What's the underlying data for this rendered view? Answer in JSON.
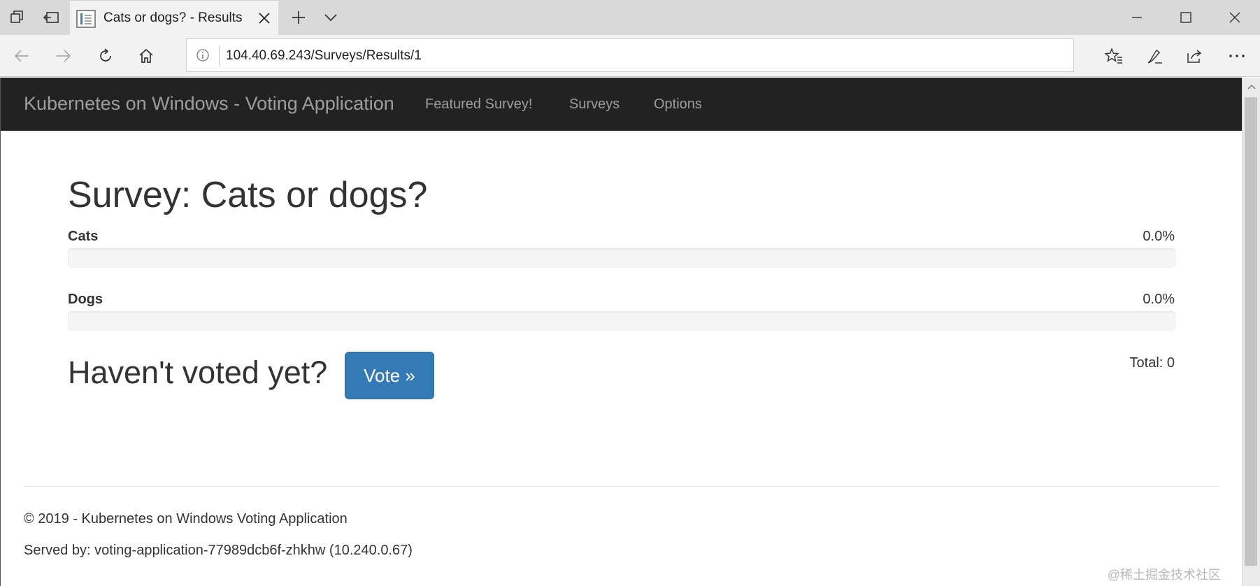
{
  "browser": {
    "tab": {
      "title": "Cats or dogs? - Results"
    },
    "address": {
      "url": "104.40.69.243/Surveys/Results/1"
    }
  },
  "app": {
    "brand": "Kubernetes on Windows - Voting Application",
    "nav": [
      {
        "label": "Featured Survey!"
      },
      {
        "label": "Surveys"
      },
      {
        "label": "Options"
      }
    ]
  },
  "survey": {
    "title": "Survey: Cats or dogs?",
    "options": [
      {
        "label": "Cats",
        "percent_text": "0.0%",
        "percent": 0
      },
      {
        "label": "Dogs",
        "percent_text": "0.0%",
        "percent": 0
      }
    ],
    "not_voted_text": "Haven't voted yet?",
    "vote_button_label": "Vote »",
    "total_text": "Total: 0"
  },
  "footer": {
    "copyright": "© 2019 - Kubernetes on Windows Voting Application",
    "served_by": "Served by: voting-application-77989dcb6f-zhkhw (10.240.0.67)"
  },
  "watermark": "@稀土掘金技术社区",
  "colors": {
    "app_navbar_bg": "#222222",
    "nav_link": "#9d9d9d",
    "primary": "#337ab7"
  }
}
